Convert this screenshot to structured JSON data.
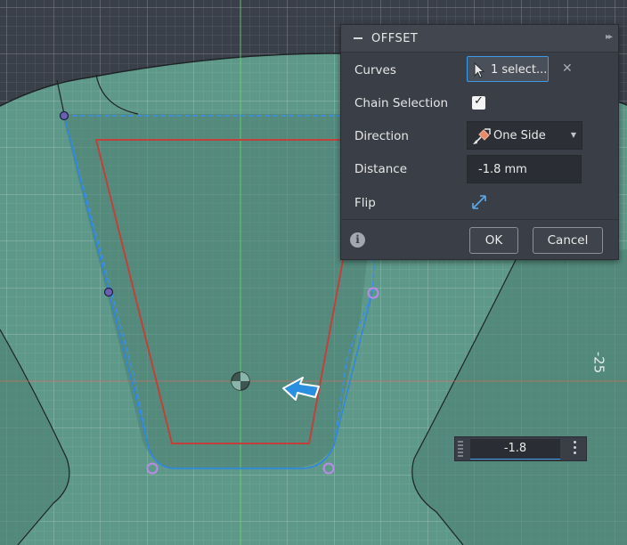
{
  "dialog": {
    "title": "OFFSET",
    "curves": {
      "label": "Curves",
      "value": "1 select..."
    },
    "chain_selection": {
      "label": "Chain Selection",
      "checked": true
    },
    "direction": {
      "label": "Direction",
      "value": "One Side"
    },
    "distance": {
      "label": "Distance",
      "value": "-1.8 mm"
    },
    "flip": {
      "label": "Flip"
    },
    "ok_label": "OK",
    "cancel_label": "Cancel"
  },
  "viewport": {
    "axis_label": "-25",
    "input_value": "-1.8"
  },
  "colors": {
    "canvas_bg": "#3a4049",
    "plane": "#5d9888",
    "selection": "#3b8fe4",
    "offset_preview": "#c2403c",
    "accent": "#3d9be9"
  },
  "icons": [
    "collapse-icon",
    "expand-icon",
    "cursor-icon",
    "clear-icon",
    "checkmark-icon",
    "direction-icon",
    "chevron-down-icon",
    "flip-icon",
    "info-icon",
    "drag-grip-icon",
    "more-options-icon",
    "origin-icon",
    "pointer-arrow-icon"
  ]
}
